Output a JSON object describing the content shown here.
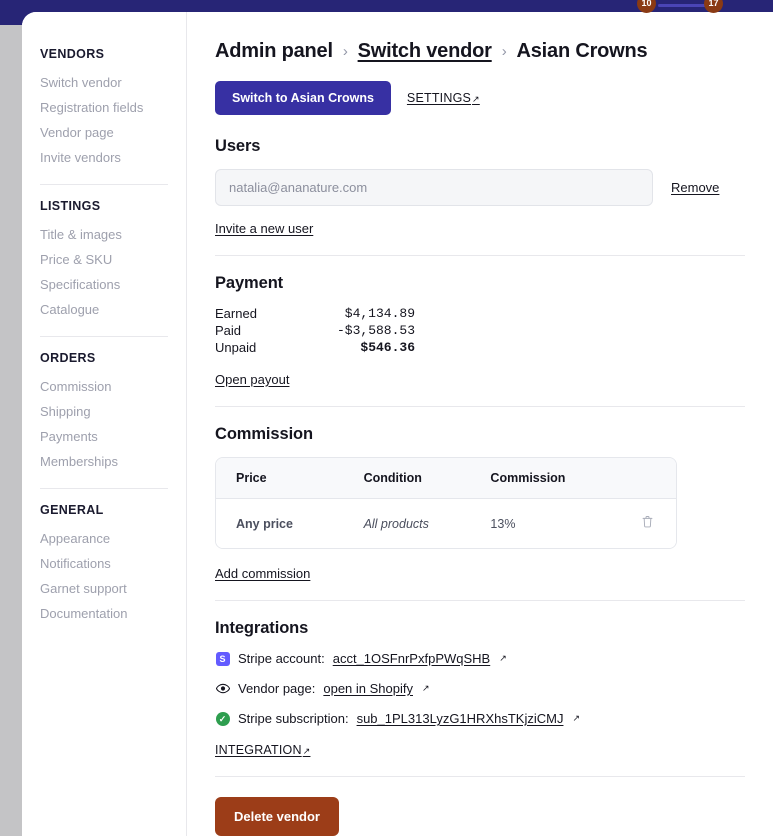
{
  "window": {
    "top_badges": [
      {
        "label": "10"
      },
      {
        "label": "17"
      }
    ],
    "navy_color": "#272576",
    "accent_color": "#3730a3",
    "danger_color": "#9c3d18"
  },
  "sidebar": {
    "groups": [
      {
        "heading": "VENDORS",
        "items": [
          {
            "label": "Switch vendor"
          },
          {
            "label": "Registration fields"
          },
          {
            "label": "Vendor page"
          },
          {
            "label": "Invite vendors"
          }
        ]
      },
      {
        "heading": "LISTINGS",
        "items": [
          {
            "label": "Title & images"
          },
          {
            "label": "Price & SKU"
          },
          {
            "label": "Specifications"
          },
          {
            "label": "Catalogue"
          }
        ]
      },
      {
        "heading": "ORDERS",
        "items": [
          {
            "label": "Commission"
          },
          {
            "label": "Shipping"
          },
          {
            "label": "Payments"
          },
          {
            "label": "Memberships"
          }
        ]
      },
      {
        "heading": "GENERAL",
        "items": [
          {
            "label": "Appearance"
          },
          {
            "label": "Notifications"
          },
          {
            "label": "Garnet support"
          },
          {
            "label": "Documentation"
          }
        ]
      }
    ]
  },
  "breadcrumb": {
    "root": "Admin panel",
    "separator": "›",
    "middle": "Switch vendor",
    "current": "Asian Crowns"
  },
  "actions": {
    "switch_button": "Switch to Asian Crowns",
    "settings_link": "SETTINGS",
    "external_arrow": "↗"
  },
  "users": {
    "title": "Users",
    "email_value": "natalia@ananature.com",
    "email_placeholder": "natalia@ananature.com",
    "remove_label": "Remove",
    "invite_label": "Invite a new user"
  },
  "payment": {
    "title": "Payment",
    "rows": [
      {
        "label": "Earned",
        "amount": "$4,134.89",
        "bold": false
      },
      {
        "label": "Paid",
        "amount": "-$3,588.53",
        "bold": false
      },
      {
        "label": "Unpaid",
        "amount": "$546.36",
        "bold": true
      }
    ],
    "open_payout_label": "Open payout"
  },
  "commission": {
    "title": "Commission",
    "columns": [
      "Price",
      "Condition",
      "Commission",
      ""
    ],
    "rows": [
      {
        "price": "Any price",
        "condition": "All products",
        "commission": "13%",
        "delete_icon": "🗑"
      }
    ],
    "add_label": "Add commission"
  },
  "integrations": {
    "title": "Integrations",
    "rows": [
      {
        "icon": "stripe-icon",
        "icon_glyph": "S",
        "label": "Stripe account:",
        "link": "acct_1OSFnrPxfpPWqSHB"
      },
      {
        "icon": "eye-icon",
        "icon_glyph": "◉",
        "label": "Vendor page:",
        "link": "open in Shopify"
      },
      {
        "icon": "check-circle-icon",
        "icon_glyph": "✓",
        "label": "Stripe subscription:",
        "link": "sub_1PL313LyzG1HRXhsTKjziCMJ"
      }
    ],
    "integration_link": "INTEGRATION"
  },
  "footer": {
    "delete_label": "Delete vendor"
  }
}
